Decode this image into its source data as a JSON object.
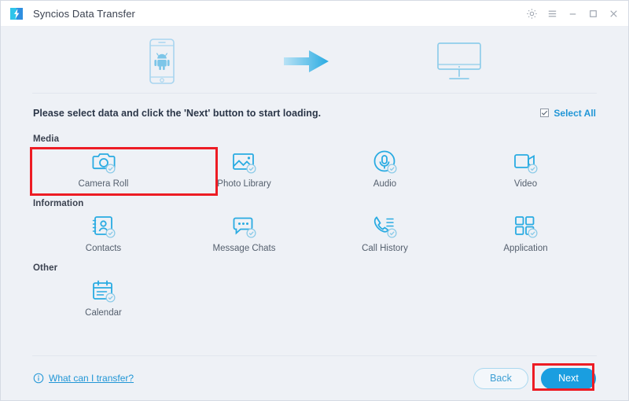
{
  "window": {
    "title": "Syncios Data Transfer",
    "logo_icon": "syncios-logo-icon",
    "controls": [
      {
        "name": "settings-button",
        "icon": "gear-icon"
      },
      {
        "name": "menu-button",
        "icon": "hamburger-menu-icon"
      },
      {
        "name": "minimize-button",
        "icon": "minimize-icon"
      },
      {
        "name": "maximize-button",
        "icon": "maximize-icon"
      },
      {
        "name": "close-button",
        "icon": "close-icon"
      }
    ]
  },
  "illustration": {
    "source_icon": "android-phone-icon",
    "arrow_icon": "arrow-right-icon",
    "target_icon": "desktop-monitor-icon"
  },
  "instruction": {
    "text": "Please select data and click the 'Next' button to start loading.",
    "select_all_label": "Select All",
    "select_all_checked": true
  },
  "groups": [
    {
      "label": "Media",
      "items": [
        {
          "label": "Camera Roll",
          "icon": "camera-icon",
          "checked": true
        },
        {
          "label": "Photo Library",
          "icon": "photo-icon",
          "checked": true
        },
        {
          "label": "Audio",
          "icon": "microphone-icon",
          "checked": true
        },
        {
          "label": "Video",
          "icon": "camcorder-icon",
          "checked": true
        }
      ]
    },
    {
      "label": "Information",
      "items": [
        {
          "label": "Contacts",
          "icon": "contact-card-icon",
          "checked": true
        },
        {
          "label": "Message Chats",
          "icon": "chat-bubble-icon",
          "checked": true
        },
        {
          "label": "Call History",
          "icon": "phone-call-icon",
          "checked": true
        },
        {
          "label": "Application",
          "icon": "app-grid-icon",
          "checked": true
        }
      ]
    },
    {
      "label": "Other",
      "items": [
        {
          "label": "Calendar",
          "icon": "calendar-icon",
          "checked": true
        }
      ]
    }
  ],
  "footer": {
    "help_icon": "info-icon",
    "help_label": "What can I transfer?",
    "back_label": "Back",
    "next_label": "Next"
  },
  "annotations": [
    {
      "name": "media-highlight-box",
      "color": "#ed1c24"
    },
    {
      "name": "next-highlight-box",
      "color": "#ed1c24"
    }
  ],
  "colors": {
    "accent": "#1a9ee0",
    "icon_blue": "#29abe2",
    "background": "#eef1f6",
    "titlebar": "#ffffff",
    "annotation_red": "#ed1c24",
    "text_dark": "#3b4250",
    "text_muted": "#55606e"
  }
}
